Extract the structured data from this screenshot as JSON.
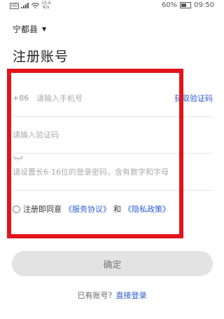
{
  "statusbar": {
    "network": "HD",
    "speed_top": "15.4",
    "speed_bottom": "K/s",
    "battery": "60%",
    "time": "09:50"
  },
  "region": {
    "label": "宁都县"
  },
  "page": {
    "title": "注册账号"
  },
  "form": {
    "phone_prefix": "+86",
    "phone_placeholder": "请输入手机号",
    "get_code_label": "获取验证码",
    "code_placeholder": "请输入验证码",
    "password_placeholder": "请设置长6-16位的登录密码，含有数字和字母"
  },
  "agreement": {
    "prefix": "注册即同意",
    "service_link": "《服务协议》",
    "and": "和",
    "privacy_link": "《隐私政策》"
  },
  "confirm_label": "确定",
  "login": {
    "question": "已有账号？",
    "link": "直接登录"
  },
  "colors": {
    "link": "#2a5bd7",
    "highlight_box": "#e0141a",
    "button_bg": "#e3e3e3"
  }
}
